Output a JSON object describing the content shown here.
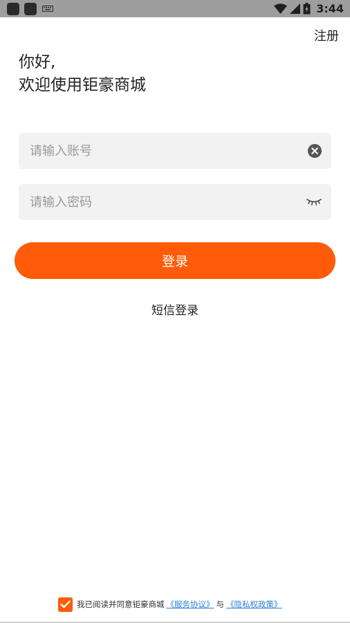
{
  "status_bar": {
    "time": "3:44",
    "icons": [
      "app-icon",
      "app-icon",
      "keyboard-icon",
      "wifi-icon",
      "signal-icon",
      "battery-icon"
    ]
  },
  "header": {
    "register_label": "注册",
    "greeting_line1": "你好,",
    "greeting_line2": "欢迎使用钜豪商城"
  },
  "form": {
    "account_placeholder": "请输入账号",
    "account_value": "",
    "account_clear_icon": "clear-icon",
    "password_placeholder": "请输入密码",
    "password_value": "",
    "password_toggle_icon": "eye-closed-icon",
    "login_label": "登录",
    "sms_login_label": "短信登录"
  },
  "agreement": {
    "checked": true,
    "prefix": "我已阅读并同意钜豪商城",
    "service_link": "《服务协议》",
    "connector": "与",
    "privacy_link": "《隐私权政策》"
  },
  "colors": {
    "accent": "#ff5b08",
    "link": "#2f7fd6",
    "status_bar": "#9e9e9e",
    "field_bg": "#f2f2f2"
  }
}
